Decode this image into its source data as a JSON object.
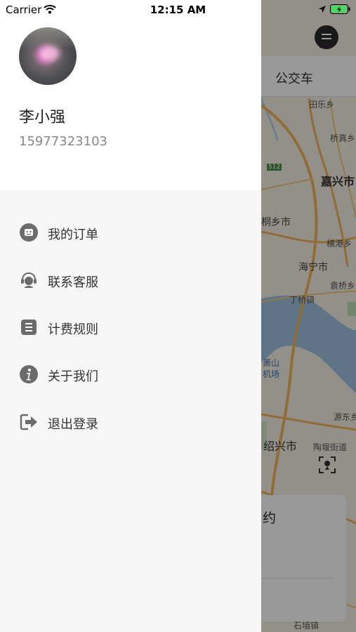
{
  "status_bar": {
    "carrier": "Carrier",
    "time": "12:15 AM"
  },
  "drawer": {
    "user": {
      "name": "李小强",
      "phone": "15977323103"
    },
    "menu": [
      {
        "label": "我的订单",
        "icon": "order-icon"
      },
      {
        "label": "联系客服",
        "icon": "customer-service-icon"
      },
      {
        "label": "计费规则",
        "icon": "rules-icon"
      },
      {
        "label": "关于我们",
        "icon": "info-icon"
      },
      {
        "label": "退出登录",
        "icon": "logout-icon"
      }
    ]
  },
  "map": {
    "top_tab": "公交车",
    "bottom_card_text": "约",
    "labels": {
      "tianle": "田乐乡",
      "qiaoxiang": "桥真乡",
      "jiaxing": "嘉兴市",
      "tongxiang": "桐乡市",
      "henggang": "横港乡",
      "haining": "海宁市",
      "yanqiao": "袁桥乡",
      "dingqiao": "丁桥镇",
      "xiaoshan": "萧山",
      "airport": "机场",
      "yuandong": "源东乡",
      "shaoxing": "绍兴市",
      "taojie": "陶堰街道",
      "shiqiao": "石墙镇",
      "road_512": "512"
    }
  },
  "colors": {
    "drawer_bg": "#f7f7f7",
    "header_bg": "#ffffff",
    "icon_gray": "#6b6b6b",
    "map_overlay": "rgba(0,0,0,0.40)"
  }
}
